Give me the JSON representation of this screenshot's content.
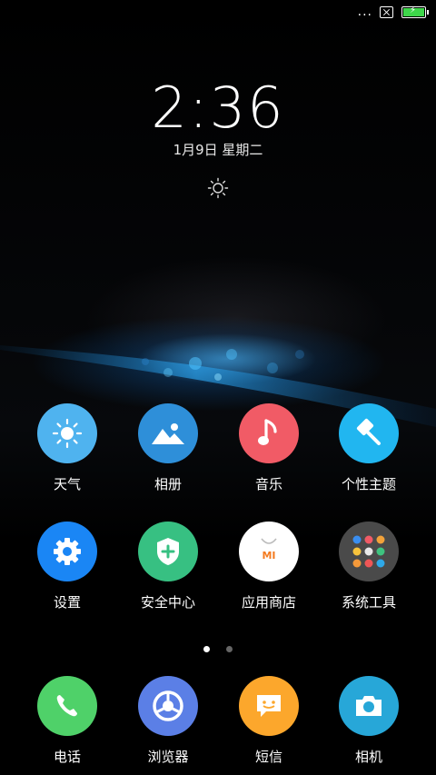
{
  "status_bar": {
    "dots": "...",
    "battery_color": "#3ed64a"
  },
  "lockscreen": {
    "time": "2:36",
    "date": "1月9日 星期二"
  },
  "apps_row1": [
    {
      "label": "天气",
      "color": "#4fb3ef",
      "icon": "weather-icon"
    },
    {
      "label": "相册",
      "color": "#2e8fd9",
      "icon": "gallery-icon"
    },
    {
      "label": "音乐",
      "color": "#f15b66",
      "icon": "music-icon"
    },
    {
      "label": "个性主题",
      "color": "#21b6f0",
      "icon": "theme-icon"
    }
  ],
  "apps_row2": [
    {
      "label": "设置",
      "color": "#1a86f5",
      "icon": "settings-icon"
    },
    {
      "label": "安全中心",
      "color": "#37c082",
      "icon": "security-icon"
    },
    {
      "label": "应用商店",
      "color": "#ffffff",
      "icon": "app-store-icon",
      "text": "MI"
    },
    {
      "label": "系统工具",
      "color": "#4a4a4a",
      "icon": "folder-icon"
    }
  ],
  "dock": [
    {
      "label": "电话",
      "color": "#4fd169",
      "icon": "phone-icon"
    },
    {
      "label": "浏览器",
      "color": "#5b7fe6",
      "icon": "browser-icon"
    },
    {
      "label": "短信",
      "color": "#fca72c",
      "icon": "messages-icon"
    },
    {
      "label": "相机",
      "color": "#27a7d8",
      "icon": "camera-icon"
    }
  ],
  "pager": {
    "active": 0,
    "count": 2
  }
}
